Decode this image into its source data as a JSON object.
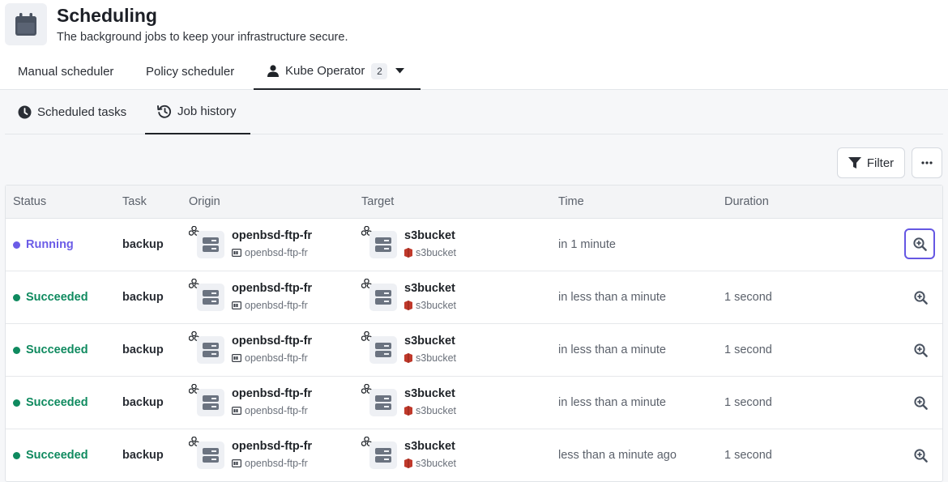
{
  "header": {
    "icon": "calendar-icon",
    "title": "Scheduling",
    "subtitle": "The background jobs to keep your infrastructure secure."
  },
  "primary_tabs": [
    {
      "label": "Manual scheduler"
    },
    {
      "label": "Policy scheduler"
    },
    {
      "label": "Kube Operator",
      "icon": "user-icon",
      "count": "2",
      "active": true
    }
  ],
  "secondary_tabs": [
    {
      "label": "Scheduled tasks",
      "icon": "clock-icon"
    },
    {
      "label": "Job history",
      "icon": "history-icon",
      "active": true
    }
  ],
  "toolbar": {
    "filter_label": "Filter",
    "more_icon": "ellipsis-icon"
  },
  "table": {
    "columns": [
      "Status",
      "Task",
      "Origin",
      "Target",
      "Time",
      "Duration"
    ],
    "rows": [
      {
        "status": "Running",
        "task": "backup",
        "origin": "openbsd-ftp-fr",
        "origin_sub": "openbsd-ftp-fr",
        "target": "s3bucket",
        "target_sub": "s3bucket",
        "time": "in 1 minute",
        "duration": ""
      },
      {
        "status": "Succeeded",
        "task": "backup",
        "origin": "openbsd-ftp-fr",
        "origin_sub": "openbsd-ftp-fr",
        "target": "s3bucket",
        "target_sub": "s3bucket",
        "time": "in less than a minute",
        "duration": "1 second"
      },
      {
        "status": "Succeeded",
        "task": "backup",
        "origin": "openbsd-ftp-fr",
        "origin_sub": "openbsd-ftp-fr",
        "target": "s3bucket",
        "target_sub": "s3bucket",
        "time": "in less than a minute",
        "duration": "1 second"
      },
      {
        "status": "Succeeded",
        "task": "backup",
        "origin": "openbsd-ftp-fr",
        "origin_sub": "openbsd-ftp-fr",
        "target": "s3bucket",
        "target_sub": "s3bucket",
        "time": "in less than a minute",
        "duration": "1 second"
      },
      {
        "status": "Succeeded",
        "task": "backup",
        "origin": "openbsd-ftp-fr",
        "origin_sub": "openbsd-ftp-fr",
        "target": "s3bucket",
        "target_sub": "s3bucket",
        "time": "less than a minute ago",
        "duration": "1 second"
      }
    ]
  },
  "colors": {
    "running": "#6b5ce7",
    "succeeded": "#0f8a5f",
    "focus_ring": "#6557e3",
    "s3_red": "#c0392b"
  }
}
